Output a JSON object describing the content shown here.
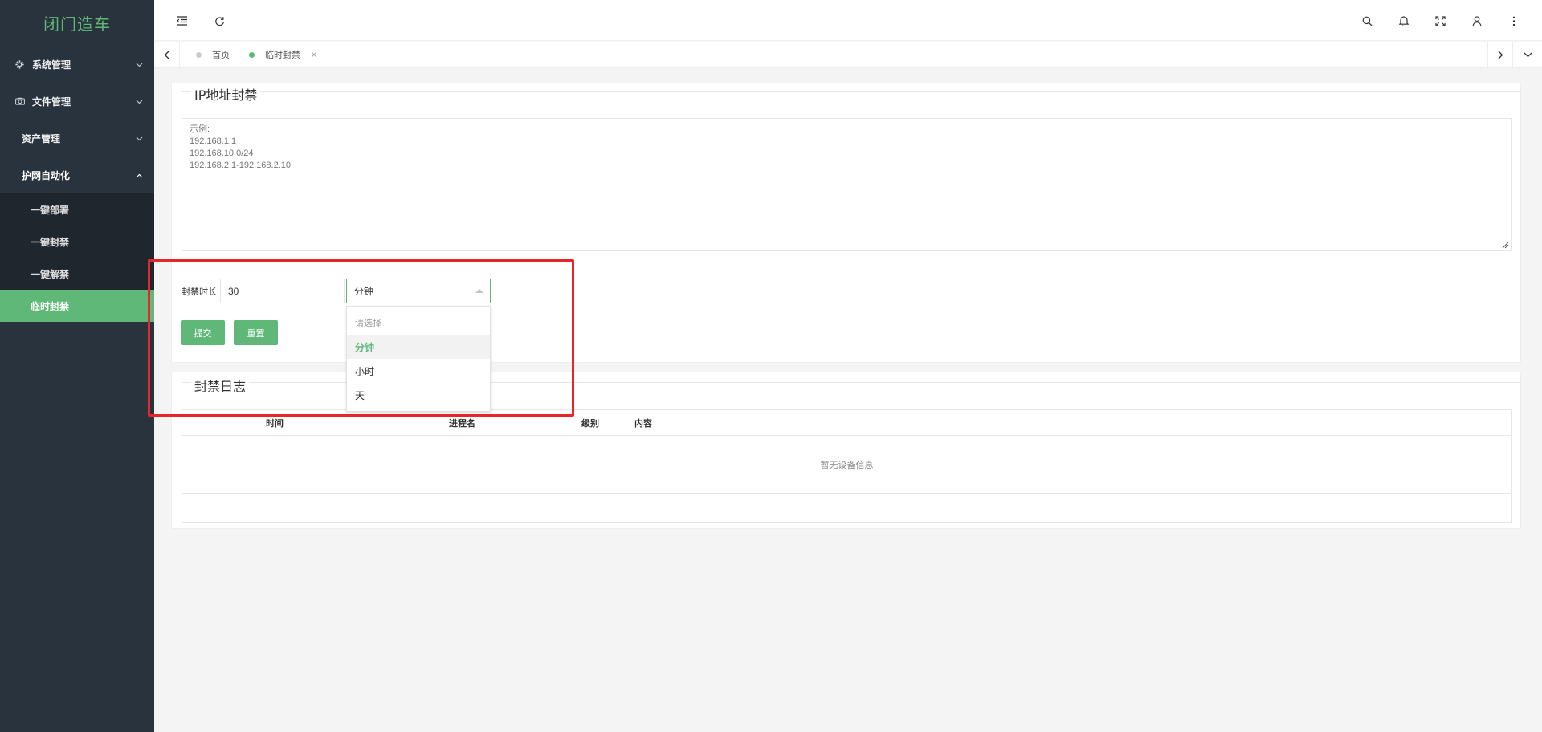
{
  "sidebar": {
    "logo": "闭门造车",
    "items": [
      {
        "label": "系统管理",
        "icon": "gear-icon",
        "arrow": "⌄"
      },
      {
        "label": "文件管理",
        "icon": "camera-icon",
        "arrow": "⌄"
      },
      {
        "label": "资产管理",
        "arrow": "⌄"
      },
      {
        "label": "护网自动化",
        "arrow": "⌃"
      }
    ],
    "sub_items": [
      {
        "label": "一键部署"
      },
      {
        "label": "一键封禁"
      },
      {
        "label": "一键解禁"
      },
      {
        "label": "临时封禁",
        "active": true
      }
    ]
  },
  "header": {
    "icons": [
      "menu-fold-icon",
      "refresh-icon",
      "search-icon",
      "bell-icon",
      "fullscreen-icon",
      "user-icon",
      "more-icon"
    ]
  },
  "tabs": {
    "items": [
      {
        "label": "首页",
        "dot_color": "#cccccc"
      },
      {
        "label": "临时封禁",
        "dot_color": "#5fb878",
        "closable": true
      }
    ],
    "close_glyph": "×"
  },
  "ip_panel": {
    "title": "IP地址封禁",
    "placeholder": "示例:\n192.168.1.1\n192.168.10.0/24\n192.168.2.1-192.168.2.10",
    "duration_label": "封禁时长",
    "duration_value": "30",
    "unit_selected": "分钟",
    "unit_options": [
      "请选择",
      "分钟",
      "小时",
      "天"
    ],
    "submit_label": "提交",
    "reset_label": "重置"
  },
  "log_panel": {
    "title": "封禁日志",
    "columns": [
      "时间",
      "进程名",
      "级别",
      "内容"
    ],
    "empty_text": "暂无设备信息"
  },
  "colors": {
    "accent": "#5fb878",
    "sidebar_bg": "#28333e",
    "highlight": "#e8262a"
  }
}
